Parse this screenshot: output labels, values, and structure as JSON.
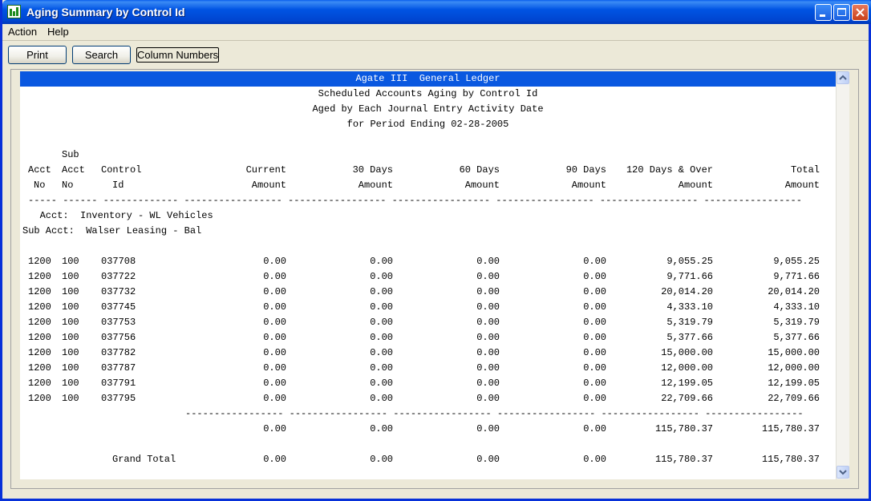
{
  "window": {
    "title": "Aging Summary by Control Id"
  },
  "menu": {
    "action": "Action",
    "help": "Help"
  },
  "toolbar": {
    "print": "Print",
    "search": "Search",
    "column_numbers": "Column Numbers"
  },
  "report": {
    "title_lines": [
      "Agate III  General Ledger",
      "Scheduled Accounts Aging by Control Id",
      "Aged by Each Journal Entry Activity Date",
      "for Period Ending 02-28-2005"
    ],
    "header": {
      "row1": {
        "sub": "Sub"
      },
      "row2": {
        "acct": "Acct",
        "subacct": "Acct",
        "control": "Control",
        "current": "Current",
        "d30": "30 Days",
        "d60": "60 Days",
        "d90": "90 Days",
        "d120": "120 Days & Over",
        "total": "Total"
      },
      "row3": {
        "acct": "No",
        "subacct": "No",
        "control": "Id",
        "current": "Amount",
        "d30": "Amount",
        "d60": "Amount",
        "d90": "Amount",
        "d120": "Amount",
        "total": "Amount"
      },
      "dashes": "----- ------ ------------- ----------------- ----------------- ----------------- ----------------- ----------------- -----------------"
    },
    "acct_line": "   Acct:  Inventory - WL Vehicles",
    "subacct_line": "Sub Acct:  Walser Leasing - Bal",
    "rows": [
      [
        "1200",
        "100",
        "037708",
        "0.00",
        "0.00",
        "0.00",
        "0.00",
        "9,055.25",
        "9,055.25"
      ],
      [
        "1200",
        "100",
        "037722",
        "0.00",
        "0.00",
        "0.00",
        "0.00",
        "9,771.66",
        "9,771.66"
      ],
      [
        "1200",
        "100",
        "037732",
        "0.00",
        "0.00",
        "0.00",
        "0.00",
        "20,014.20",
        "20,014.20"
      ],
      [
        "1200",
        "100",
        "037745",
        "0.00",
        "0.00",
        "0.00",
        "0.00",
        "4,333.10",
        "4,333.10"
      ],
      [
        "1200",
        "100",
        "037753",
        "0.00",
        "0.00",
        "0.00",
        "0.00",
        "5,319.79",
        "5,319.79"
      ],
      [
        "1200",
        "100",
        "037756",
        "0.00",
        "0.00",
        "0.00",
        "0.00",
        "5,377.66",
        "5,377.66"
      ],
      [
        "1200",
        "100",
        "037782",
        "0.00",
        "0.00",
        "0.00",
        "0.00",
        "15,000.00",
        "15,000.00"
      ],
      [
        "1200",
        "100",
        "037787",
        "0.00",
        "0.00",
        "0.00",
        "0.00",
        "12,000.00",
        "12,000.00"
      ],
      [
        "1200",
        "100",
        "037791",
        "0.00",
        "0.00",
        "0.00",
        "0.00",
        "12,199.05",
        "12,199.05"
      ],
      [
        "1200",
        "100",
        "037795",
        "0.00",
        "0.00",
        "0.00",
        "0.00",
        "22,709.66",
        "22,709.66"
      ]
    ],
    "subtotal_dashes": "----------------- ----------------- ----------------- ----------------- ----------------- -----------------",
    "subtotal": [
      "0.00",
      "0.00",
      "0.00",
      "0.00",
      "115,780.37",
      "115,780.37"
    ],
    "grand_total_label": "Grand Total",
    "grand_total": [
      "0.00",
      "0.00",
      "0.00",
      "0.00",
      "115,780.37",
      "115,780.37"
    ]
  },
  "colors": {
    "highlight": "#0a58e0",
    "titlebar": "#0054e3"
  },
  "icons": [
    "app-icon",
    "minimize-icon",
    "maximize-icon",
    "close-icon",
    "scroll-up-icon",
    "scroll-down-icon"
  ]
}
